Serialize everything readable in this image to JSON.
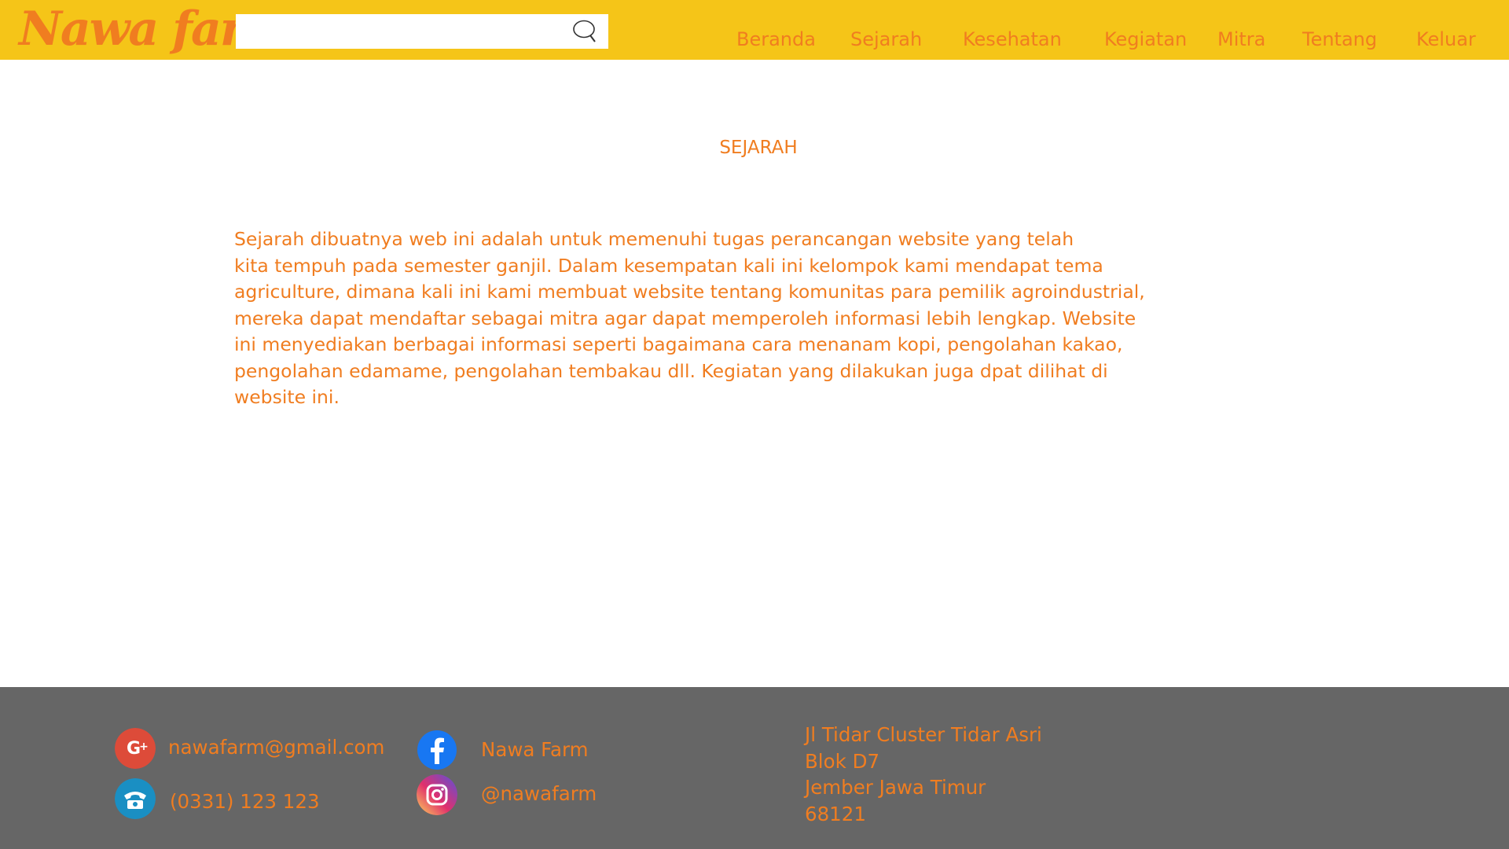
{
  "header": {
    "logo_text": "Nawa farm",
    "search": {
      "value": "",
      "placeholder": ""
    },
    "nav": [
      {
        "label": "Beranda"
      },
      {
        "label": "Sejarah"
      },
      {
        "label": "Kesehatan"
      },
      {
        "label": "Kegiatan"
      },
      {
        "label": "Mitra"
      },
      {
        "label": "Tentang"
      },
      {
        "label": "Keluar"
      }
    ]
  },
  "main": {
    "title": "SEJARAH",
    "paragraph_lines": [
      "Sejarah dibuatnya web ini adalah untuk memenuhi tugas perancangan website yang telah",
      "kita tempuh pada semester ganjil. Dalam kesempatan kali ini kelompok kami mendapat tema",
      "agriculture, dimana kali ini kami membuat website tentang komunitas para pemilik agroindustrial,",
      "mereka dapat mendaftar sebagai mitra agar dapat memperoleh informasi lebih lengkap. Website",
      "ini menyediakan berbagai informasi seperti bagaimana cara menanam kopi, pengolahan kakao,",
      "pengolahan edamame, pengolahan tembakau dll. Kegiatan yang dilakukan juga dpat dilihat di",
      "website ini."
    ]
  },
  "footer": {
    "email": {
      "icon": "google-plus-icon",
      "text": "nawafarm@gmail.com"
    },
    "phone": {
      "icon": "telephone-icon",
      "text": "(0331) 123 123"
    },
    "facebook": {
      "icon": "facebook-icon",
      "text": "Nawa Farm"
    },
    "instagram": {
      "icon": "instagram-icon",
      "text": "@nawafarm"
    },
    "address_lines": [
      "Jl Tidar Cluster Tidar Asri",
      "Blok D7",
      "Jember Jawa Timur",
      "68121"
    ]
  },
  "colors": {
    "header_bg": "#f5c518",
    "accent_text": "#f07d20",
    "footer_bg": "#666666",
    "google_plus": "#dd4b39",
    "phone": "#1a8fc3",
    "facebook": "#1877f2"
  }
}
